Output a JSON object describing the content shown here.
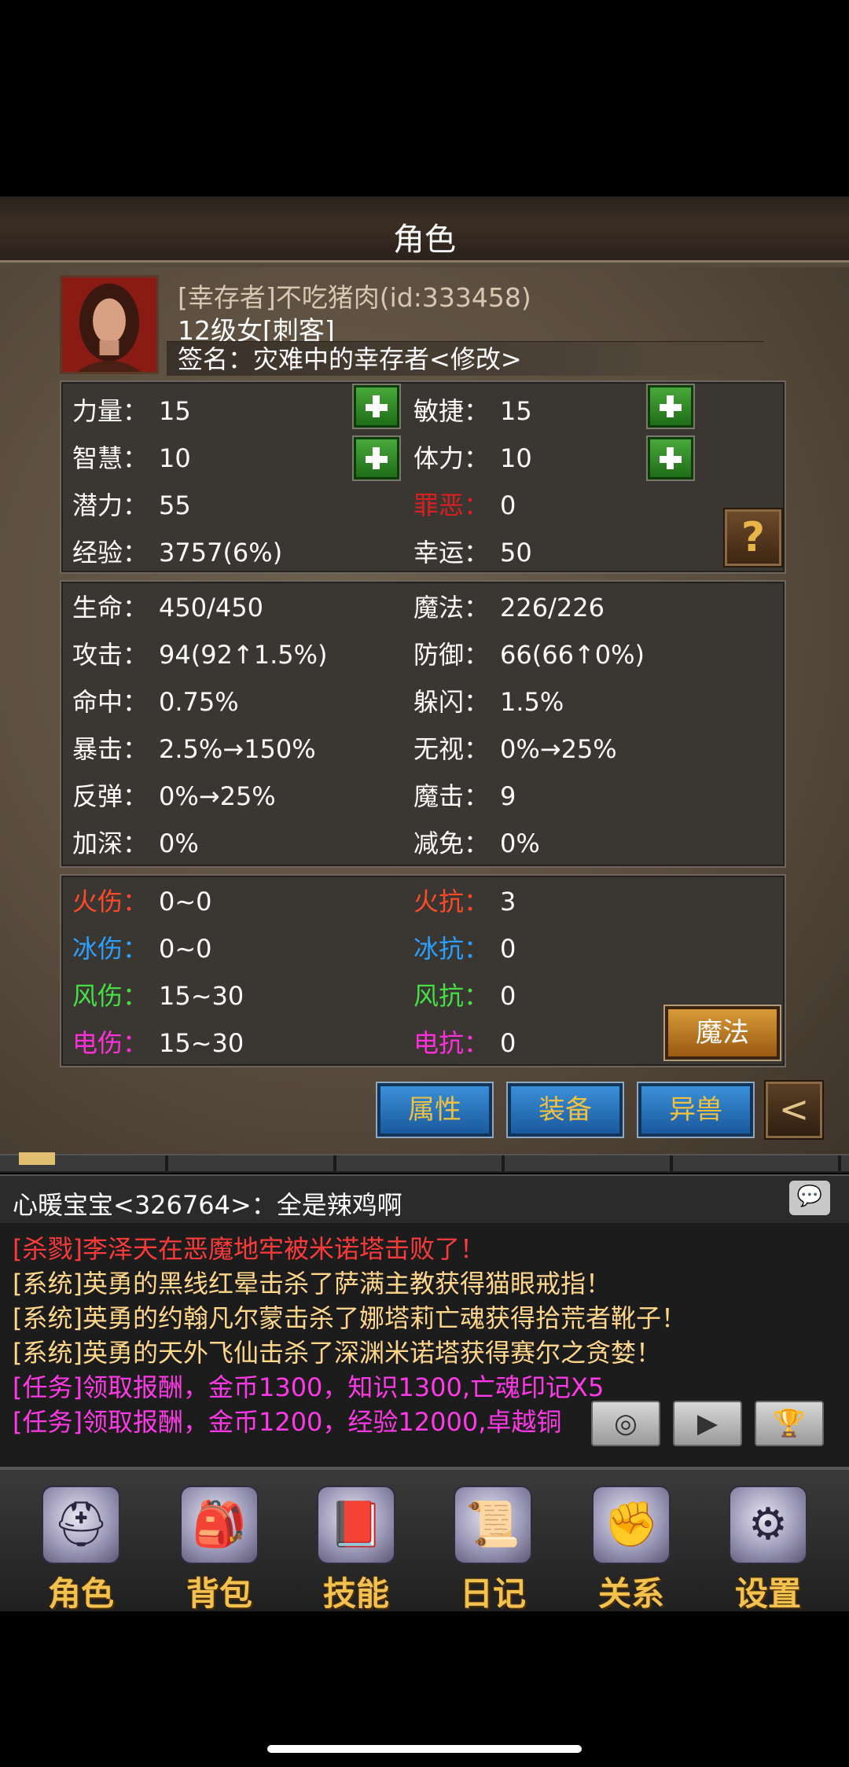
{
  "title": "角色",
  "profile": {
    "name": "[幸存者]不吃猪肉(id:333458)",
    "level_class": "12级女[刺客]",
    "signature": "签名：灾难中的幸存者<修改>"
  },
  "base_stats": {
    "strength": {
      "label": "力量：",
      "value": "15"
    },
    "agility": {
      "label": "敏捷：",
      "value": "15"
    },
    "wisdom": {
      "label": "智慧：",
      "value": "10"
    },
    "stamina": {
      "label": "体力：",
      "value": "10"
    },
    "potential": {
      "label": "潜力：",
      "value": "55"
    },
    "sin": {
      "label": "罪恶：",
      "value": "0"
    },
    "exp": {
      "label": "经验：",
      "value": "3757(6%)"
    },
    "luck": {
      "label": "幸运：",
      "value": "50"
    },
    "help_icon": "?"
  },
  "combat_stats": {
    "hp": {
      "label": "生命：",
      "value": "450/450"
    },
    "mp": {
      "label": "魔法：",
      "value": "226/226"
    },
    "attack": {
      "label": "攻击：",
      "value": "94(92↑1.5%)"
    },
    "defense": {
      "label": "防御：",
      "value": "66(66↑0%)"
    },
    "hit": {
      "label": "命中：",
      "value": "0.75%"
    },
    "dodge": {
      "label": "躲闪：",
      "value": "1.5%"
    },
    "crit": {
      "label": "暴击：",
      "value": "2.5%→150%"
    },
    "ignore": {
      "label": "无视：",
      "value": "0%→25%"
    },
    "reflect": {
      "label": "反弹：",
      "value": "0%→25%"
    },
    "magic_hit": {
      "label": "魔击：",
      "value": "9"
    },
    "deepen": {
      "label": "加深：",
      "value": "0%"
    },
    "reduce": {
      "label": "减免：",
      "value": "0%"
    }
  },
  "element_stats": {
    "fire_dmg": {
      "label": "火伤：",
      "value": "0~0"
    },
    "fire_res": {
      "label": "火抗：",
      "value": "3"
    },
    "ice_dmg": {
      "label": "冰伤：",
      "value": "0~0"
    },
    "ice_res": {
      "label": "冰抗：",
      "value": "0"
    },
    "wind_dmg": {
      "label": "风伤：",
      "value": "15~30"
    },
    "wind_res": {
      "label": "风抗：",
      "value": "0"
    },
    "elec_dmg": {
      "label": "电伤：",
      "value": "15~30"
    },
    "elec_res": {
      "label": "电抗：",
      "value": "0"
    },
    "magic_button": "魔法"
  },
  "element_colors": {
    "fire": "#ff4a2a",
    "ice": "#2aa0ff",
    "wind": "#44e044",
    "elec": "#ff30d8",
    "sin": "#d82020"
  },
  "tabs": {
    "attributes": "属性",
    "equipment": "装备",
    "beast": "异兽",
    "back": "<"
  },
  "chat": {
    "first_line": "心暖宝宝<326764>：全是辣鸡啊",
    "messages": [
      "[杀戮]李泽天在恶魔地牢被米诺塔击败了！",
      "[系统]英勇的黑线红晕击杀了萨满主教获得猫眼戒指！",
      "[系统]英勇的约翰凡尔蒙击杀了娜塔莉亡魂获得拾荒者靴子！",
      "[系统]英勇的天外飞仙击杀了深渊米诺塔获得赛尔之贪婪！",
      "[任务]领取报酬，金币1300，知识1300,亡魂印记X5",
      "[任务]领取报酬，金币1200，经验12000,卓越铜"
    ],
    "controls": {
      "compass_icon": "compass-icon",
      "play_icon": "play-icon",
      "trophy_icon": "trophy-icon"
    }
  },
  "nav": {
    "items": [
      {
        "label": "角色",
        "icon": "helmet-icon"
      },
      {
        "label": "背包",
        "icon": "backpack-icon"
      },
      {
        "label": "技能",
        "icon": "spellbook-icon"
      },
      {
        "label": "日记",
        "icon": "scroll-icon"
      },
      {
        "label": "关系",
        "icon": "gauntlet-icon"
      },
      {
        "label": "设置",
        "icon": "gear-icon"
      }
    ]
  }
}
